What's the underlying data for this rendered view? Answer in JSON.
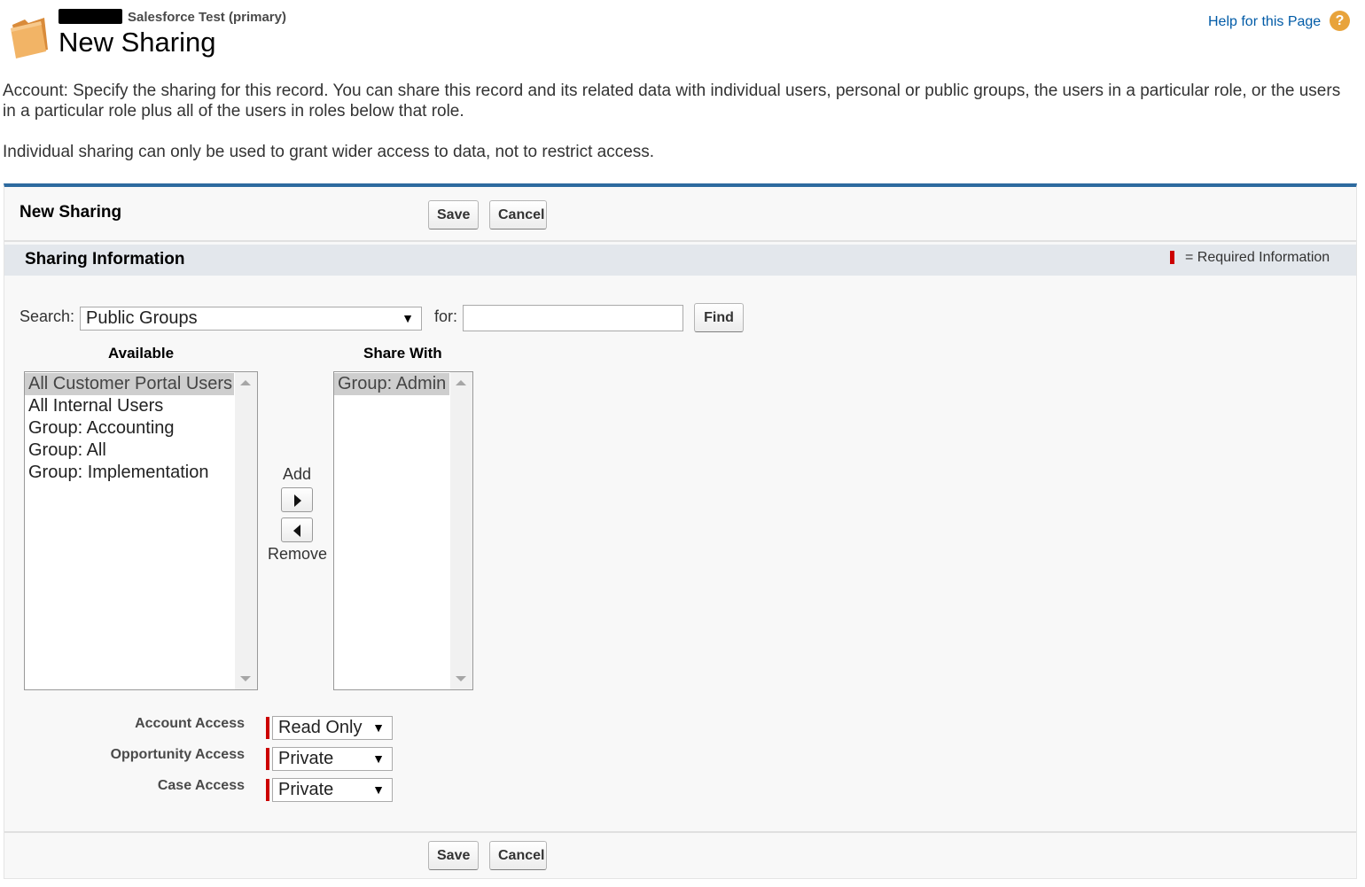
{
  "header": {
    "org_name": "Salesforce Test (primary)",
    "page_title": "New Sharing",
    "help_link": "Help for this Page",
    "help_icon": "?"
  },
  "description": {
    "line1": "Account: Specify the sharing for this record. You can share this record and its related data with individual users, personal or public groups, the users in a particular role, or the users in a particular role plus all of the users in roles below that role.",
    "line2": "Individual sharing can only be used to grant wider access to data, not to restrict access."
  },
  "panel": {
    "title": "New Sharing",
    "save_label": "Save",
    "cancel_label": "Cancel",
    "section_title": "Sharing Information",
    "required_info": "= Required Information"
  },
  "search": {
    "label": "Search:",
    "selected": "Public Groups",
    "for_label": "for:",
    "for_value": "",
    "find_label": "Find"
  },
  "available": {
    "heading": "Available",
    "items": [
      "All Customer Portal Users",
      "All Internal Users",
      "Group: Accounting",
      "Group: All",
      "Group: Implementation"
    ]
  },
  "share_with": {
    "heading": "Share With",
    "items": [
      "Group: Admin"
    ]
  },
  "mover": {
    "add_label": "Add",
    "remove_label": "Remove"
  },
  "access": {
    "account_label": "Account Access",
    "account_value": "Read Only",
    "opportunity_label": "Opportunity Access",
    "opportunity_value": "Private",
    "case_label": "Case Access",
    "case_value": "Private"
  },
  "colors": {
    "accent": "#2d6a9f",
    "required": "#cc0000",
    "link": "#015ba7",
    "help_icon": "#e8a33b"
  }
}
